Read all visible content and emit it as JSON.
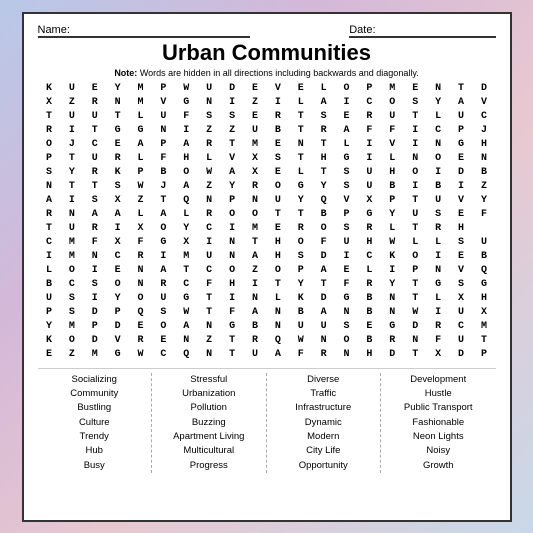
{
  "header": {
    "name_label": "Name:",
    "date_label": "Date:",
    "title": "Urban Communities",
    "note_bold": "Note:",
    "note_text": "Words are hidden in all directions including backwards and diagonally."
  },
  "grid": [
    [
      "K",
      "U",
      "E",
      "Y",
      "M",
      "P",
      "W",
      "U",
      "D",
      "E",
      "V",
      "E",
      "L",
      "O",
      "P",
      "M",
      "E",
      "N",
      "T",
      "D"
    ],
    [
      "X",
      "Z",
      "R",
      "N",
      "M",
      "V",
      "G",
      "N",
      "I",
      "Z",
      "I",
      "L",
      "A",
      "I",
      "C",
      "O",
      "S",
      "Y",
      "A",
      "V"
    ],
    [
      "T",
      "U",
      "U",
      "T",
      "L",
      "U",
      "F",
      "S",
      "S",
      "E",
      "R",
      "T",
      "S",
      "E",
      "R",
      "U",
      "T",
      "L",
      "U",
      "C"
    ],
    [
      "R",
      "I",
      "T",
      "G",
      "G",
      "N",
      "I",
      "Z",
      "Z",
      "U",
      "B",
      "T",
      "R",
      "A",
      "F",
      "F",
      "I",
      "C",
      "P",
      "J"
    ],
    [
      "O",
      "J",
      "C",
      "E",
      "A",
      "P",
      "A",
      "R",
      "T",
      "M",
      "E",
      "N",
      "T",
      "L",
      "I",
      "V",
      "I",
      "N",
      "G",
      "H"
    ],
    [
      "P",
      "T",
      "U",
      "R",
      "L",
      "F",
      "H",
      "L",
      "V",
      "X",
      "S",
      "T",
      "H",
      "G",
      "I",
      "L",
      "N",
      "O",
      "E",
      "N"
    ],
    [
      "S",
      "Y",
      "R",
      "K",
      "P",
      "B",
      "O",
      "W",
      "A",
      "X",
      "E",
      "L",
      "T",
      "S",
      "U",
      "H",
      "O",
      "I",
      "D",
      "B"
    ],
    [
      "N",
      "T",
      "T",
      "S",
      "W",
      "J",
      "A",
      "Z",
      "Y",
      "R",
      "O",
      "G",
      "Y",
      "S",
      "U",
      "B",
      "I",
      "B",
      "I",
      "Z"
    ],
    [
      "A",
      "I",
      "S",
      "X",
      "Z",
      "T",
      "Q",
      "N",
      "P",
      "N",
      "U",
      "Y",
      "Q",
      "V",
      "X",
      "P",
      "T",
      "U",
      "V",
      "Y"
    ],
    [
      "R",
      "N",
      "A",
      "A",
      "L",
      "A",
      "L",
      "R",
      "O",
      "O",
      "T",
      "T",
      "B",
      "P",
      "G",
      "Y",
      "U",
      "S",
      "E",
      "F"
    ],
    [
      "T",
      "U",
      "R",
      "I",
      "X",
      "O",
      "Y",
      "C",
      "I",
      "M",
      "E",
      "R",
      "O",
      "S",
      "R",
      "L",
      "T",
      "R",
      "H",
      ""
    ],
    [
      "C",
      "M",
      "F",
      "X",
      "F",
      "G",
      "X",
      "I",
      "N",
      "T",
      "H",
      "O",
      "F",
      "U",
      "H",
      "W",
      "L",
      "L",
      "S",
      "U"
    ],
    [
      "I",
      "M",
      "N",
      "C",
      "R",
      "I",
      "M",
      "U",
      "N",
      "A",
      "H",
      "S",
      "D",
      "I",
      "C",
      "K",
      "O",
      "I",
      "E",
      "B"
    ],
    [
      "L",
      "O",
      "I",
      "E",
      "N",
      "A",
      "T",
      "C",
      "O",
      "Z",
      "O",
      "P",
      "A",
      "E",
      "L",
      "I",
      "P",
      "N",
      "V",
      "Q"
    ],
    [
      "B",
      "C",
      "S",
      "O",
      "N",
      "R",
      "C",
      "F",
      "H",
      "I",
      "T",
      "Y",
      "T",
      "F",
      "R",
      "Y",
      "T",
      "G",
      "S",
      "G"
    ],
    [
      "U",
      "S",
      "I",
      "Y",
      "O",
      "U",
      "G",
      "T",
      "I",
      "N",
      "L",
      "K",
      "D",
      "G",
      "B",
      "N",
      "T",
      "L",
      "X",
      "H"
    ],
    [
      "P",
      "S",
      "D",
      "P",
      "Q",
      "S",
      "W",
      "T",
      "F",
      "A",
      "N",
      "B",
      "A",
      "N",
      "B",
      "N",
      "W",
      "I",
      "U",
      "X"
    ],
    [
      "Y",
      "M",
      "P",
      "D",
      "E",
      "O",
      "A",
      "N",
      "G",
      "B",
      "N",
      "U",
      "U",
      "S",
      "E",
      "G",
      "D",
      "R",
      "C",
      "M"
    ],
    [
      "K",
      "O",
      "D",
      "V",
      "R",
      "E",
      "N",
      "Z",
      "T",
      "R",
      "Q",
      "W",
      "N",
      "O",
      "B",
      "R",
      "N",
      "F",
      "U",
      "T"
    ],
    [
      "E",
      "Z",
      "M",
      "G",
      "W",
      "C",
      "Q",
      "N",
      "T",
      "U",
      "A",
      "F",
      "R",
      "N",
      "H",
      "D",
      "T",
      "X",
      "D",
      "P"
    ]
  ],
  "word_columns": [
    {
      "words": [
        "Socializing",
        "Community",
        "Bustling",
        "Culture",
        "Trendy",
        "Hub",
        "Busy"
      ]
    },
    {
      "words": [
        "Stressful",
        "Urbanization",
        "Pollution",
        "Buzzing",
        "Apartment Living",
        "Multicultural",
        "Progress"
      ]
    },
    {
      "words": [
        "Diverse",
        "Traffic",
        "Infrastructure",
        "Dynamic",
        "Modern",
        "City Life",
        "Opportunity"
      ]
    },
    {
      "words": [
        "Development",
        "Hustle",
        "Public Transport",
        "Fashionable",
        "Neon Lights",
        "Noisy",
        "Growth"
      ]
    }
  ]
}
